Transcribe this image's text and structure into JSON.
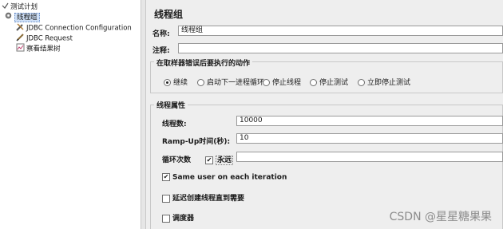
{
  "tree": {
    "root_label": "测试计划",
    "thread_group_label": "线程组",
    "items": [
      {
        "label": "JDBC Connection Configuration"
      },
      {
        "label": "JDBC Request"
      },
      {
        "label": "察看结果树"
      }
    ]
  },
  "panel": {
    "title": "线程组",
    "name_label": "名称:",
    "name_value": "线程组",
    "comment_label": "注释:",
    "comment_value": "",
    "error_group_title": "在取样器错误后要执行的动作",
    "error_actions": [
      {
        "label": "继续",
        "selected": true
      },
      {
        "label": "启动下一进程循环",
        "selected": false
      },
      {
        "label": "停止线程",
        "selected": false
      },
      {
        "label": "停止测试",
        "selected": false
      },
      {
        "label": "立即停止测试",
        "selected": false
      }
    ],
    "props_group_title": "线程属性",
    "threads_label": "线程数:",
    "threads_value": "10000",
    "rampup_label": "Ramp-Up时间(秒):",
    "rampup_value": "10",
    "loop_label": "循环次数",
    "forever_label": "永远",
    "forever_checked": true,
    "loop_value": "",
    "same_user_label": "Same user on each iteration",
    "same_user_checked": true,
    "delay_label": "延迟创建线程直到需要",
    "delay_checked": false,
    "scheduler_label": "调度器",
    "scheduler_checked": false
  },
  "watermark": "CSDN @星星糖果果",
  "colors": {
    "selection": "#cfe0f7",
    "panel_bg": "#eeeeee"
  }
}
